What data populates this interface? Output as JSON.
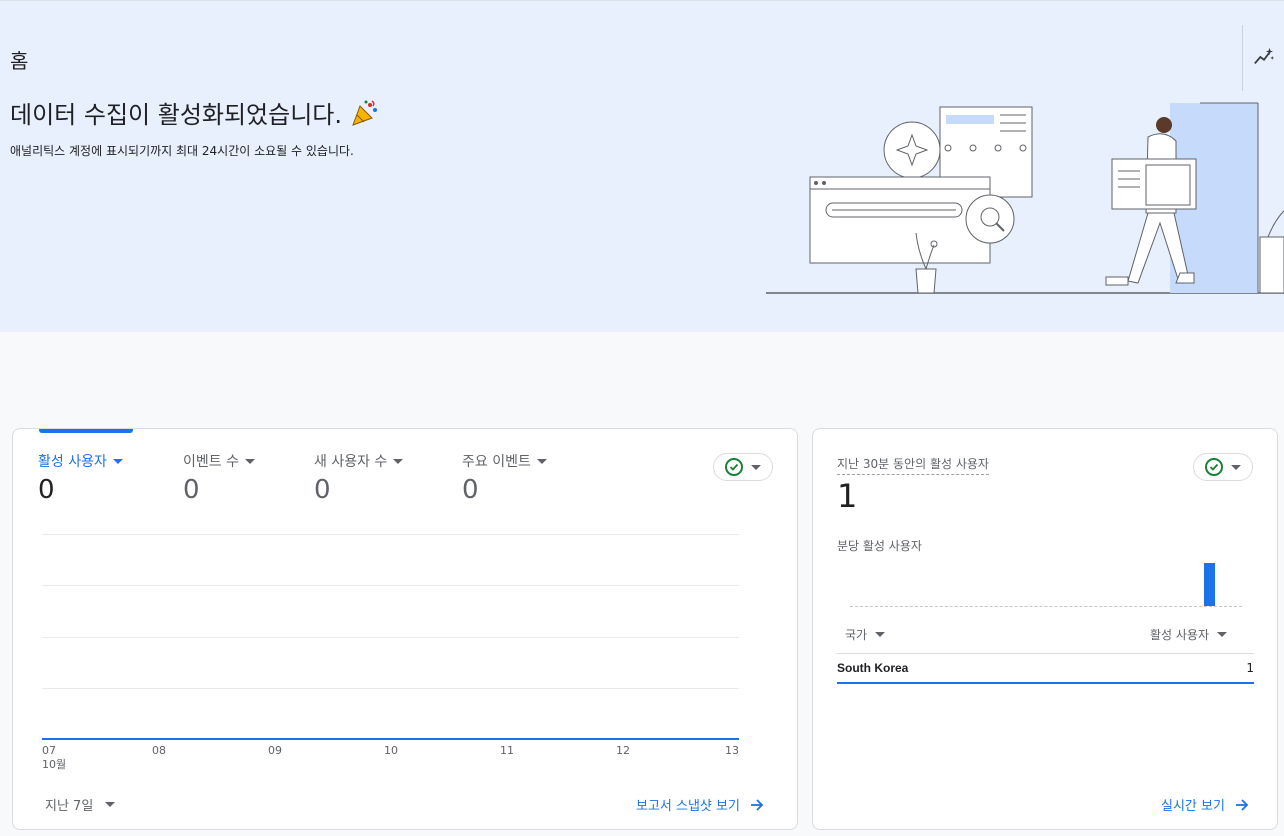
{
  "page": {
    "title": "홈"
  },
  "hero": {
    "headline": "데이터 수집이 활성화되었습니다.",
    "subline": "애널리틱스 계정에 표시되기까지 최대 24시간이 소요될 수 있습니다.",
    "celebration_icon": "party-popper-icon",
    "insights_icon": "insights-sparkle-icon"
  },
  "overview_card": {
    "metrics": [
      {
        "label": "활성 사용자",
        "value": "0",
        "active": true
      },
      {
        "label": "이벤트 수",
        "value": "0",
        "active": false
      },
      {
        "label": "새 사용자 수",
        "value": "0",
        "active": false
      },
      {
        "label": "주요 이벤트",
        "value": "0",
        "active": false
      }
    ],
    "status_icon": "check-circle-icon",
    "x_ticks": [
      "07",
      "08",
      "09",
      "10",
      "11",
      "12",
      "13"
    ],
    "x_month": "10월",
    "date_range": "지난 7일",
    "footer_link": "보고서 스냅샷 보기"
  },
  "realtime_card": {
    "title": "지난 30분 동안의 활성 사용자",
    "value": "1",
    "subtitle": "분당 활성 사용자",
    "col_country": "국가",
    "col_users": "활성 사용자",
    "rows": [
      {
        "country": "South Korea",
        "users": "1"
      }
    ],
    "footer_link": "실시간 보기"
  },
  "chart_data": [
    {
      "type": "line",
      "title": "",
      "x": [
        "07",
        "08",
        "09",
        "10",
        "11",
        "12",
        "13"
      ],
      "xlabel": "10월",
      "series": [
        {
          "name": "활성 사용자",
          "values": [
            0,
            0,
            0,
            0,
            0,
            0,
            0
          ]
        }
      ],
      "grid": true
    },
    {
      "type": "bar",
      "title": "분당 활성 사용자",
      "x_minutes": 30,
      "values": [
        0,
        0,
        0,
        0,
        0,
        0,
        0,
        0,
        0,
        0,
        0,
        0,
        0,
        0,
        0,
        0,
        0,
        0,
        0,
        0,
        0,
        0,
        0,
        0,
        0,
        0,
        0,
        1,
        0,
        0
      ],
      "ylim": [
        0,
        1
      ]
    }
  ],
  "colors": {
    "accent": "#1a73e8",
    "hero_bg": "#e8f0fe",
    "success": "#188038"
  }
}
